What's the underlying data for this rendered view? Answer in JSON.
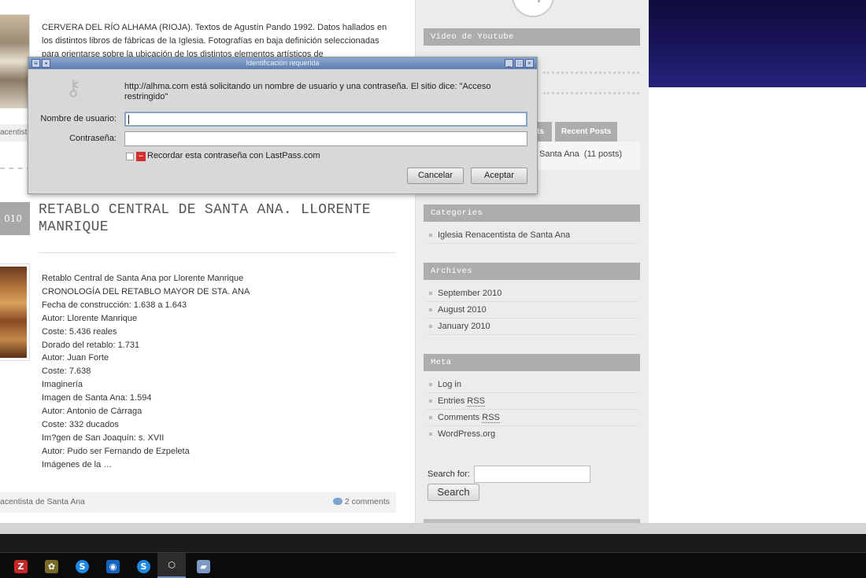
{
  "post1": {
    "excerpt": "CERVERA DEL RÍO ALHAMA (RIOJA). Textos de Agustín Pando 1992. Datos hallados en los distintos libros de fábricas de la Iglesia. Fotografías en baja definición seleccionadas para orientarse sobre la ubicación de los distintos elementos artísticos de",
    "category_clip": "acentist"
  },
  "post2": {
    "date_clip": "010",
    "title": "RETABLO CENTRAL DE SANTA ANA. LLORENTE MANRIQUE",
    "lines": [
      "Retablo Central de Santa Ana por Llorente Manrique",
      "CRONOLOGÍA DEL RETABLO MAYOR DE STA. ANA",
      "Fecha de construcción: 1.638 a 1.643",
      "Autor: Llorente Manrique",
      "Coste: 5.436 reales",
      "Dorado del retablo: 1.731",
      "Autor: Juan Forte",
      "Coste: 7.638",
      "Imaginería",
      "Imagen de Santa Ana: 1.594",
      "Autor: Antonio de Cárraga",
      "Coste: 332 ducados",
      "Im?gen de San Joaquín: s. XVII",
      "Autor: Pudo ser Fernando de Ezpeleta",
      "Imágenes de la …"
    ],
    "footer_category": "acentista de Santa Ana",
    "comments": "2 comments"
  },
  "sidebar": {
    "video_title": "Video de Youtube",
    "tab_clipped": "ts",
    "tab_recent": "Recent Posts",
    "tab_content_link": "Santa Ana",
    "tab_content_count": "(11 posts)",
    "categories_title": "Categories",
    "categories": [
      "Iglesia Renacentista de Santa Ana"
    ],
    "archives_title": "Archives",
    "archives": [
      "September 2010",
      "August 2010",
      "January 2010"
    ],
    "meta_title": "Meta",
    "meta": {
      "login": "Log in",
      "entries_prefix": "Entries ",
      "comments_prefix": "Comments ",
      "rss": "RSS",
      "wordpress": "WordPress.org"
    },
    "search_label": "Search for:",
    "search_value": "",
    "search_button": "Search"
  },
  "dialog": {
    "title": "Identificación requerida",
    "message": "http://alhma.com está solicitando un nombre de usuario y una contraseña. El sitio dice: \"Acceso restringido\"",
    "username_label": "Nombre de usuario:",
    "password_label": "Contraseña:",
    "username_value": "",
    "password_value": "",
    "remember_label": "Recordar esta contraseña con LastPass.com",
    "lastpass_icon_text": "•••",
    "cancel_label": "Cancelar",
    "accept_label": "Aceptar",
    "icons": [
      "key-icon",
      "lastpass-icon"
    ]
  },
  "taskbar": {
    "apps": [
      {
        "name": "filezilla",
        "glyph": "Z",
        "color": "#c62828"
      },
      {
        "name": "network",
        "glyph": "✿",
        "color": "#7a6a2a"
      },
      {
        "name": "skype-1",
        "glyph": "S",
        "color": "#1e88e5"
      },
      {
        "name": "messenger",
        "glyph": "◉",
        "color": "#1565c0"
      },
      {
        "name": "skype-2",
        "glyph": "S",
        "color": "#1e88e5"
      },
      {
        "name": "virtualbox",
        "glyph": "⬡",
        "color": "#2c2c2c"
      },
      {
        "name": "notes",
        "glyph": "▰",
        "color": "#7d9ac4"
      }
    ]
  },
  "colors": {
    "widget_header": "#adadad",
    "sidebar_bg": "#ececec",
    "dialog_titlebar": "#6f8ec0",
    "right_panel_dark": "#1b1760",
    "taskbar": "#0c0c0c"
  }
}
